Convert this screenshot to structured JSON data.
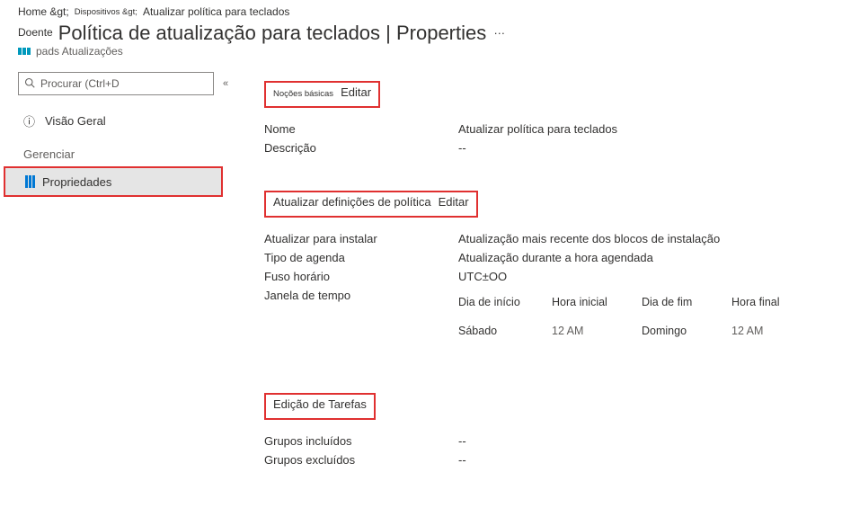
{
  "breadcrumb": {
    "home": "Home &gt;",
    "devices": "Dispositivos &gt;",
    "current": "Atualizar política para teclados"
  },
  "header": {
    "doente": "Doente",
    "title": "Política de atualização para teclados | Properties",
    "dots": "…",
    "subhead": "pads Atualizações"
  },
  "left": {
    "search_placeholder": "Procurar (Ctrl+D",
    "overview": "Visão Geral",
    "manage_label": "Gerenciar",
    "properties": "Propriedades"
  },
  "sections": {
    "basics": {
      "title": "Noções básicas",
      "edit": "Editar"
    },
    "policy": {
      "title": "Atualizar definições de política",
      "edit": "Editar"
    },
    "assignments": {
      "title": "Edição de Tarefas"
    }
  },
  "basics_kv": {
    "name_k": "Nome",
    "name_v": "Atualizar política para teclados",
    "desc_k": "Descrição",
    "desc_v": "--"
  },
  "policy_kv": {
    "install_k": "Atualizar para instalar",
    "install_v": "Atualização mais recente dos blocos de instalação",
    "sched_k": "Tipo de agenda",
    "sched_v": "Atualização durante a hora agendada",
    "tz_k": "Fuso horário",
    "tz_v": "UTC±OO",
    "tw_k": "Janela de tempo"
  },
  "time_window": {
    "h1": "Dia de início",
    "h2": "Hora inicial",
    "h3": "Dia de fim",
    "h4": "Hora final",
    "c1": "Sábado",
    "c2": "12 AM",
    "c3": "Domingo",
    "c4": "12 AM"
  },
  "assignments_kv": {
    "inc_k": "Grupos incluídos",
    "inc_v": "--",
    "exc_k": "Grupos excluídos",
    "exc_v": "--"
  }
}
